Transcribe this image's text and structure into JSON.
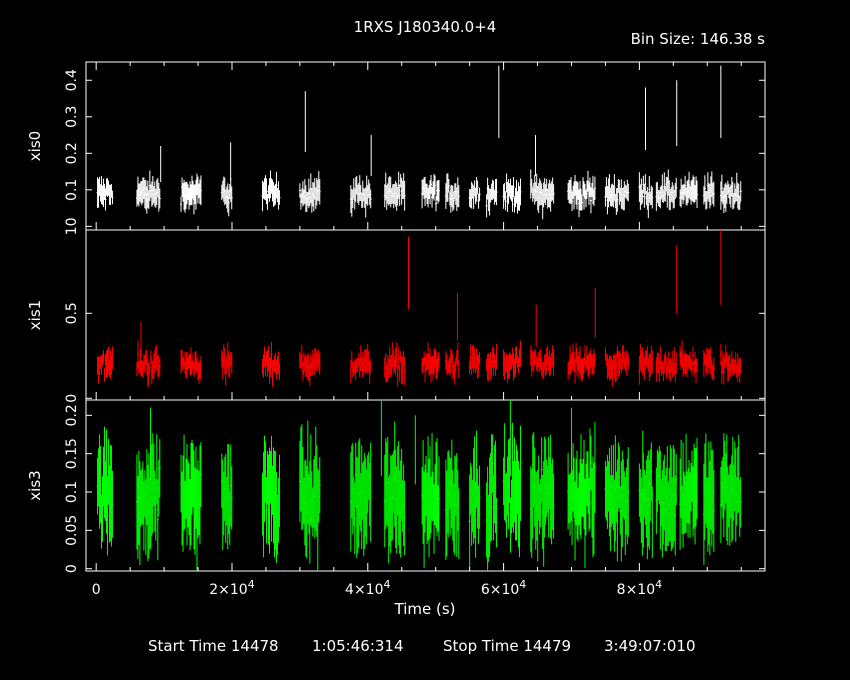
{
  "title": "1RXS J180340.0+4",
  "bin_size_label": "Bin Size: 146.38 s",
  "xlabel": "Time (s)",
  "footer": {
    "start_label": "Start Time 14478",
    "start_time": "1:05:46:314",
    "stop_label": "Stop Time 14479",
    "stop_time": "3:49:07:010"
  },
  "colors": {
    "background": "#000000",
    "axes": "#ffffff",
    "xis0": "#ffffff",
    "xis1": "#ff0000",
    "xis3": "#00ff00"
  },
  "chart_data": {
    "type": "scatter",
    "x_ticks": [
      {
        "value": 0,
        "label": "0"
      },
      {
        "value": 20000,
        "label": "2×10",
        "exp": "4"
      },
      {
        "value": 40000,
        "label": "4×10",
        "exp": "4"
      },
      {
        "value": 60000,
        "label": "6×10",
        "exp": "4"
      },
      {
        "value": 80000,
        "label": "8×10",
        "exp": "4"
      }
    ],
    "xlim": [
      -1500,
      98500
    ],
    "observation_windows": [
      [
        200,
        2500
      ],
      [
        6000,
        9500
      ],
      [
        12500,
        15500
      ],
      [
        18500,
        20000
      ],
      [
        24500,
        27000
      ],
      [
        30000,
        33000
      ],
      [
        37500,
        40500
      ],
      [
        42500,
        45500
      ],
      [
        48000,
        50500
      ],
      [
        51500,
        53500
      ],
      [
        55000,
        56500
      ],
      [
        57500,
        59000
      ],
      [
        60000,
        62500
      ],
      [
        64000,
        67500
      ],
      [
        69500,
        73500
      ],
      [
        75000,
        78500
      ],
      [
        80000,
        82000
      ],
      [
        82500,
        85500
      ],
      [
        86000,
        88500
      ],
      [
        89500,
        91000
      ],
      [
        92000,
        95000
      ]
    ],
    "panels": [
      {
        "name": "xis0",
        "ylabel": "xis0",
        "color": "#ffffff",
        "ylim": [
          -0.01,
          0.45
        ],
        "yticks": [
          0.1,
          0.2,
          0.3,
          0.4
        ],
        "yticklabels": [
          "0.1",
          "0.2",
          "0.3",
          "0.4"
        ],
        "zero_label": "10",
        "mean": 0.09,
        "scatter": 0.022,
        "err": 0.03,
        "peaks": [
          [
            9500,
            0.22
          ],
          [
            19800,
            0.23
          ],
          [
            30800,
            0.37
          ],
          [
            40500,
            0.25
          ],
          [
            59300,
            0.44
          ],
          [
            64700,
            0.25
          ],
          [
            80900,
            0.38
          ],
          [
            85500,
            0.4
          ],
          [
            92000,
            0.44
          ]
        ]
      },
      {
        "name": "xis1",
        "ylabel": "xis1",
        "color": "#ff0000",
        "ylim": [
          -0.01,
          0.99
        ],
        "yticks": [
          0.5
        ],
        "yticklabels": [
          "0.5"
        ],
        "zero_label": "0",
        "mean": 0.2,
        "scatter": 0.05,
        "err": 0.06,
        "peaks": [
          [
            6600,
            0.45
          ],
          [
            46000,
            0.95
          ],
          [
            53200,
            0.62
          ],
          [
            64800,
            0.55
          ],
          [
            73500,
            0.65
          ],
          [
            85500,
            0.9
          ],
          [
            92000,
            1.0
          ]
        ]
      },
      {
        "name": "xis3",
        "ylabel": "xis3",
        "color": "#00ff00",
        "ylim": [
          -0.003,
          0.22
        ],
        "yticks": [
          0.05,
          0.1,
          0.15,
          0.2
        ],
        "yticklabels": [
          "0.05",
          "0.1",
          "0.15",
          "0.2"
        ],
        "zero_label": "0",
        "mean": 0.095,
        "scatter": 0.03,
        "err": 0.05,
        "peaks": [
          [
            8000,
            0.21
          ],
          [
            42000,
            0.22
          ],
          [
            47000,
            0.2
          ],
          [
            61000,
            0.22
          ],
          [
            70000,
            0.21
          ],
          [
            80500,
            0.18
          ]
        ]
      }
    ]
  }
}
